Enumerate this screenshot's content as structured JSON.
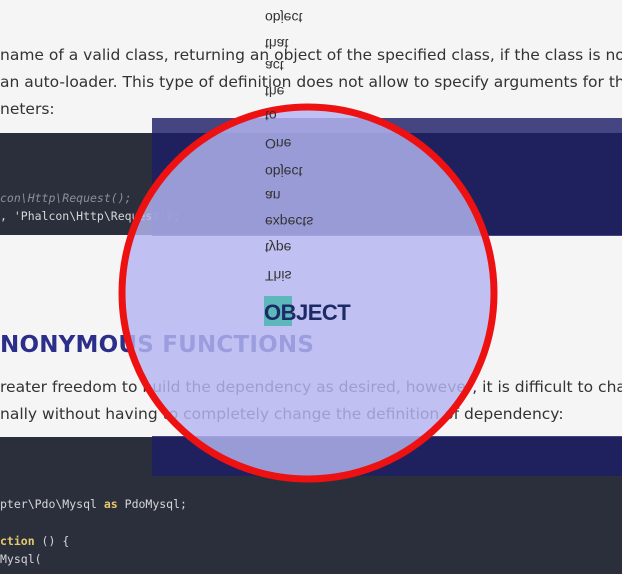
{
  "paragraph1": {
    "line1": "name of a valid class, returning an object of the specified class, if the class is not lo",
    "line2": "an auto-loader. This type of definition does not allow to specify arguments for the",
    "line3": "neters:"
  },
  "code1": {
    "line1": "con\\Http\\Request();",
    "line2": ", 'Phalcon\\Http\\Request');"
  },
  "heading": "NONYMOUS FUNCTIONS",
  "paragraph2": {
    "line1": "reater freedom to build the dependency as desired, however, it is difficult to chang",
    "line2": "nally without having to completely change the definition of dependency:"
  },
  "code2": {
    "line1_path": "pter\\Pdo\\Mysql ",
    "line1_kw": "as",
    "line1_alias": " PdoMysql;",
    "line2_kw": "ction",
    "line2_rest": " () {",
    "line3": "Mysql("
  },
  "ghost_words": [
    "object",
    "that",
    "act",
    "the",
    "to",
    "One",
    "object",
    "an",
    "expects",
    "type",
    "This"
  ],
  "magnified_word": "OBJECT",
  "colors": {
    "circle_stroke": "#ee1111",
    "circle_fill": "#b4b6f2",
    "overlay": "#1d1e68",
    "code_bg": "#2b2f3b",
    "heading": "#2c2f8a"
  }
}
